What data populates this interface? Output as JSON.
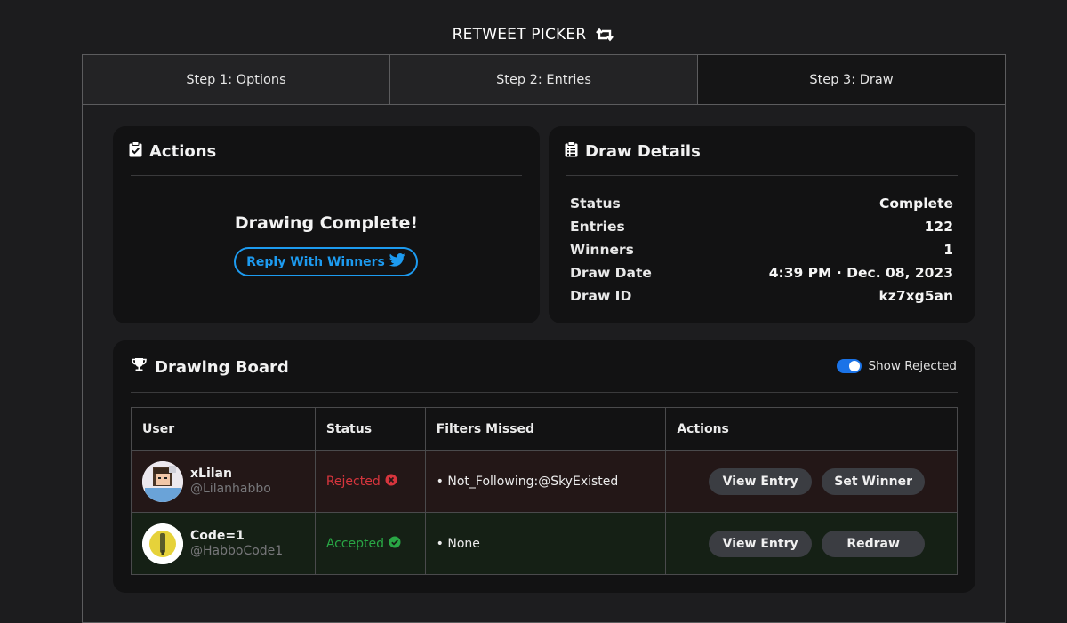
{
  "app": {
    "title": "RETWEET PICKER",
    "title_icon": "retweet-icon"
  },
  "steps": [
    {
      "label": "Step 1: Options"
    },
    {
      "label": "Step 2: Entries"
    },
    {
      "label": "Step 3: Draw",
      "active": true
    }
  ],
  "actions": {
    "title": "Actions",
    "title_icon": "clipboard-check-icon",
    "message": "Drawing Complete!",
    "reply_button": "Reply With Winners",
    "reply_icon": "twitter-bird-icon"
  },
  "details": {
    "title": "Draw Details",
    "title_icon": "clipboard-list-icon",
    "rows": [
      {
        "label": "Status",
        "value": "Complete"
      },
      {
        "label": "Entries",
        "value": "122"
      },
      {
        "label": "Winners",
        "value": "1"
      },
      {
        "label": "Draw Date",
        "value": "4:39 PM · Dec. 08, 2023"
      },
      {
        "label": "Draw ID",
        "value": "kz7xg5an"
      }
    ]
  },
  "board": {
    "title": "Drawing Board",
    "title_icon": "trophy-icon",
    "toggle_label": "Show Rejected",
    "toggle_on": true,
    "columns": [
      "User",
      "Status",
      "Filters Missed",
      "Actions"
    ],
    "rows": [
      {
        "name": "xLilan",
        "handle": "@Lilanhabbo",
        "status": "Rejected",
        "status_icon": "x-circle-icon",
        "filters": "• Not_Following:@SkyExisted",
        "action1": "View Entry",
        "action2": "Set Winner"
      },
      {
        "name": "Code=1",
        "handle": "@HabboCode1",
        "status": "Accepted",
        "status_icon": "check-circle-icon",
        "filters": "• None",
        "action1": "View Entry",
        "action2": "Redraw"
      }
    ]
  },
  "colors": {
    "accent_blue": "#1d9bf0",
    "rejected_red": "#d7353d",
    "accepted_green": "#29a745",
    "toggle_blue": "#1a73e8"
  }
}
